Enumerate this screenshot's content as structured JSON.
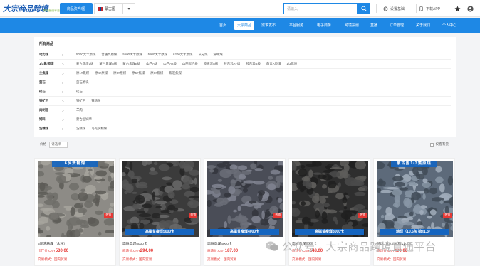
{
  "header": {
    "logo_text": "大宗商品跨境",
    "logo_sub": "跨境直通平台",
    "main_tab": "商品资产/国",
    "country": "蒙古国",
    "search_placeholder": "请输入",
    "settings": "设置基础",
    "download": "下载APP"
  },
  "nav": [
    "首页",
    "大宗商品",
    "需求发布",
    "平台服务",
    "电子商务",
    "跨境投融",
    "直播",
    "订单管理",
    "关于我们",
    "个人中心"
  ],
  "filters": {
    "title": "所有商品",
    "rows": [
      {
        "label": "动力煤",
        "options": [
          "5000大卡原煤",
          "普通高原煤",
          "5500大卡原煤",
          "5800大卡原煤",
          "6200大卡原煤",
          "灰分煤",
          "洗中煤"
        ]
      },
      {
        "label": "1/3焦/原煤",
        "options": [
          "蒙古焦煤1级",
          "蒙古焦煤A级",
          "蒙古焦煤B级",
          "山西A级",
          "山西A2级",
          "山西混合级",
          "胶东混A级",
          "胶东混A+级",
          "胶东混B级",
          "白音A原煤",
          "1/3焦原"
        ]
      },
      {
        "label": "主焦煤",
        "options": [
          "原1#焦煤",
          "原4#原煤",
          "原5#原煤",
          "原5#焦煤",
          "原8#焦煤",
          "焦炭焦煤"
        ]
      },
      {
        "label": "萤石",
        "options": [
          "萤石原块"
        ]
      },
      {
        "label": "硅石",
        "options": [
          "硅石"
        ]
      },
      {
        "label": "铁矿石",
        "options": [
          "铁矿石",
          "铁精粉"
        ]
      },
      {
        "label": "肉制品",
        "options": [
          "羊肉"
        ]
      },
      {
        "label": "饲料",
        "options": [
          "蒙古国饲草"
        ]
      },
      {
        "label": "洗精煤",
        "options": [
          "洗精煤",
          "马克洗精煤"
        ]
      }
    ]
  },
  "sort": {
    "price_label": "价格",
    "select_value": "请选择",
    "checkbox_label": "仅看有货"
  },
  "products": [
    {
      "top_banner": "6灰洗精煤",
      "banner": "",
      "hot": "热销",
      "name": "6灰洗精煤（含税）",
      "price_prefix": "出厂价:CNY",
      "price": "530.00",
      "trade": "交易模式：国内贸易"
    },
    {
      "top_banner": "",
      "banner": "高磁贫瘦煤5000卡",
      "hot": "热销",
      "name": "高磁电煤5000卡",
      "price_prefix": "商场价:CNY",
      "price": "294.00",
      "trade": "交易模式：国内贸易"
    },
    {
      "top_banner": "",
      "banner": "高磁贫瘦煤4000卡",
      "hot": "热销",
      "name": "高磁电煤4000卡",
      "price_prefix": "商场价:CNY",
      "price": "187.00",
      "trade": "交易模式：国内贸易"
    },
    {
      "top_banner": "",
      "banner": "高磁贫瘦煤3000卡",
      "hot": "热销",
      "name": "高磁电煤3000卡",
      "price_prefix": "商场价:CNY",
      "price": "148.00",
      "trade": "交易模式：国内贸易"
    },
    {
      "top_banner": "蒙古国1/3焦原煤",
      "banner": "精煤（10.5灰 硫≤1.3）",
      "hot": "热销",
      "name": "精煤（10.5灰 硫≤1.3）",
      "price_prefix": "商场价:CNY",
      "price": "490.00",
      "trade": "交易模式：国内贸易"
    }
  ],
  "watermark": "公众号 · 大宗商品跨境直通平台",
  "colors": {
    "primary": "#1e88e5",
    "price": "#e53935"
  }
}
